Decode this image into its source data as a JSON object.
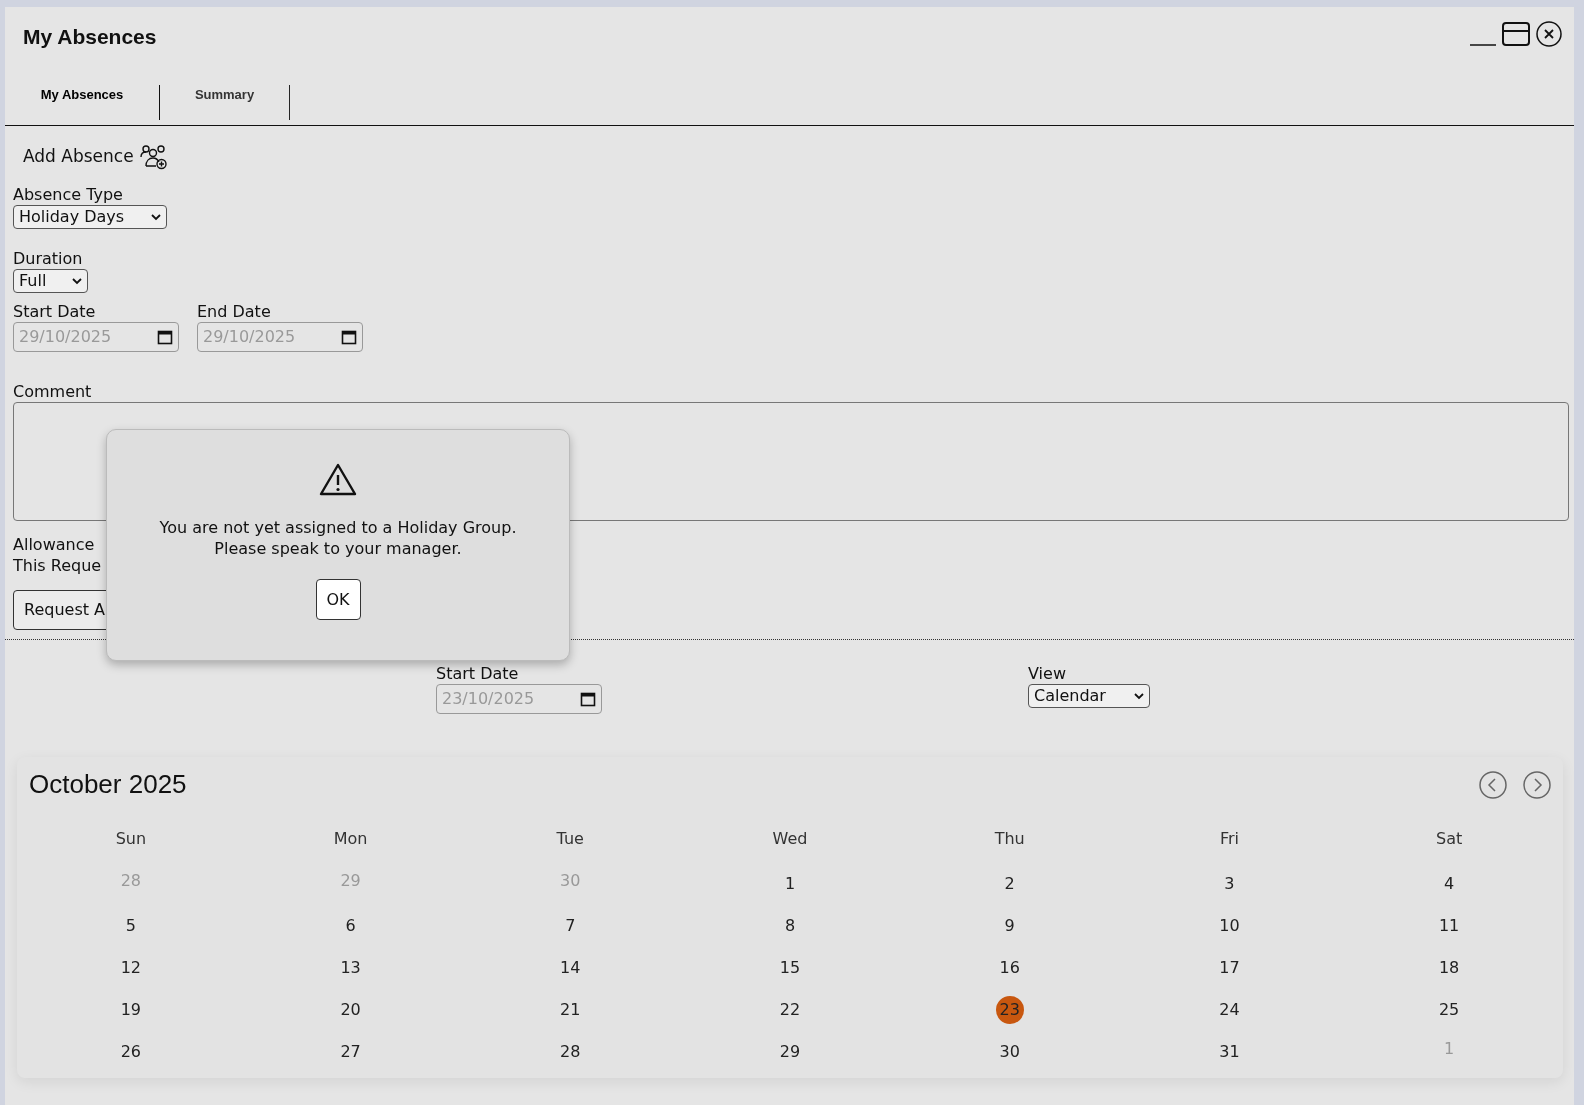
{
  "window": {
    "title": "My Absences"
  },
  "tabs": [
    {
      "label": "My Absences",
      "selected": true
    },
    {
      "label": "Summary",
      "selected": false
    }
  ],
  "add_absence": {
    "heading": "Add Absence"
  },
  "absence_type": {
    "label": "Absence Type",
    "value": "Holiday Days"
  },
  "duration": {
    "label": "Duration",
    "value": "Full"
  },
  "start_date": {
    "label": "Start Date",
    "value": "29/10/2025",
    "disabled": true
  },
  "end_date": {
    "label": "End Date",
    "value": "29/10/2025",
    "disabled": true
  },
  "comment": {
    "label": "Comment"
  },
  "allowance_lines": [
    "Allowance",
    "This Reque"
  ],
  "request_button": "Request A",
  "filter": {
    "start_label": "Start Date",
    "start_value": "23/10/2025",
    "start_disabled": true,
    "view_label": "View",
    "view_value": "Calendar"
  },
  "calendar": {
    "title": "October 2025",
    "weekdays": [
      "Sun",
      "Mon",
      "Tue",
      "Wed",
      "Thu",
      "Fri",
      "Sat"
    ],
    "weeks": [
      [
        {
          "day": "28",
          "in_month": false,
          "selected": false
        },
        {
          "day": "29",
          "in_month": false,
          "selected": false
        },
        {
          "day": "30",
          "in_month": false,
          "selected": false
        },
        {
          "day": "1",
          "in_month": true,
          "selected": false
        },
        {
          "day": "2",
          "in_month": true,
          "selected": false
        },
        {
          "day": "3",
          "in_month": true,
          "selected": false
        },
        {
          "day": "4",
          "in_month": true,
          "selected": false
        }
      ],
      [
        {
          "day": "5",
          "in_month": true,
          "selected": false
        },
        {
          "day": "6",
          "in_month": true,
          "selected": false
        },
        {
          "day": "7",
          "in_month": true,
          "selected": false
        },
        {
          "day": "8",
          "in_month": true,
          "selected": false
        },
        {
          "day": "9",
          "in_month": true,
          "selected": false
        },
        {
          "day": "10",
          "in_month": true,
          "selected": false
        },
        {
          "day": "11",
          "in_month": true,
          "selected": false
        }
      ],
      [
        {
          "day": "12",
          "in_month": true,
          "selected": false
        },
        {
          "day": "13",
          "in_month": true,
          "selected": false
        },
        {
          "day": "14",
          "in_month": true,
          "selected": false
        },
        {
          "day": "15",
          "in_month": true,
          "selected": false
        },
        {
          "day": "16",
          "in_month": true,
          "selected": false
        },
        {
          "day": "17",
          "in_month": true,
          "selected": false
        },
        {
          "day": "18",
          "in_month": true,
          "selected": false
        }
      ],
      [
        {
          "day": "19",
          "in_month": true,
          "selected": false
        },
        {
          "day": "20",
          "in_month": true,
          "selected": false
        },
        {
          "day": "21",
          "in_month": true,
          "selected": false
        },
        {
          "day": "22",
          "in_month": true,
          "selected": false
        },
        {
          "day": "23",
          "in_month": true,
          "selected": true
        },
        {
          "day": "24",
          "in_month": true,
          "selected": false
        },
        {
          "day": "25",
          "in_month": true,
          "selected": false
        }
      ],
      [
        {
          "day": "26",
          "in_month": true,
          "selected": false
        },
        {
          "day": "27",
          "in_month": true,
          "selected": false
        },
        {
          "day": "28",
          "in_month": true,
          "selected": false
        },
        {
          "day": "29",
          "in_month": true,
          "selected": false
        },
        {
          "day": "30",
          "in_month": true,
          "selected": false
        },
        {
          "day": "31",
          "in_month": true,
          "selected": false
        },
        {
          "day": "1",
          "in_month": false,
          "selected": false
        }
      ]
    ]
  },
  "dialog": {
    "lines": [
      "You are not yet assigned to a Holiday Group.",
      "Please speak to your manager."
    ],
    "button": "OK"
  }
}
